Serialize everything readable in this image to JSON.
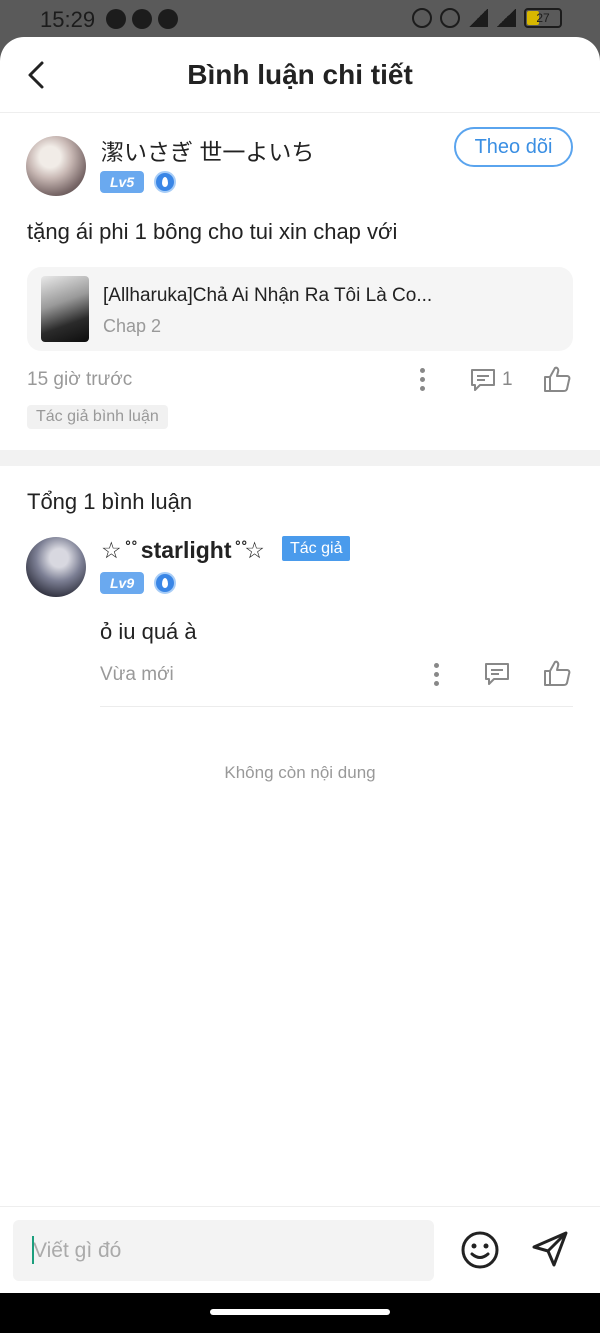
{
  "status_bar": {
    "time": "15:29",
    "battery": "27",
    "icons": [
      "messenger-icon",
      "tiktok-icon",
      "pinterest-icon",
      "alarm-icon",
      "nfc-icon",
      "wifi-icon",
      "signal-icon",
      "battery-icon"
    ]
  },
  "header": {
    "title": "Bình luận chi tiết"
  },
  "main_comment": {
    "username": "潔いさぎ 世一よいち",
    "level": "Lv5",
    "follow_label": "Theo dõi",
    "text": "tặng ái phi 1 bông cho tui xin chap với",
    "manga": {
      "title": "[Allharuka]Chả Ai Nhận Ra Tôi Là Co...",
      "chapter": "Chap 2"
    },
    "time": "15 giờ trước",
    "reply_count": "1",
    "tag": "Tác giả bình luận"
  },
  "replies_section": {
    "total_label": "Tổng 1 bình luận",
    "replies": [
      {
        "username": "☆ ̊ ̊ starlight ̊ ̊☆",
        "author_tag": "Tác giả",
        "level": "Lv9",
        "text": "ỏ iu quá à",
        "time": "Vừa mới"
      }
    ],
    "end_text": "Không còn nội dung"
  },
  "input_bar": {
    "placeholder": "Viết gì đó"
  },
  "colors": {
    "accent": "#3b8fe3",
    "level_badge": "#6aa9ef",
    "author_tag": "#4a9bec"
  }
}
